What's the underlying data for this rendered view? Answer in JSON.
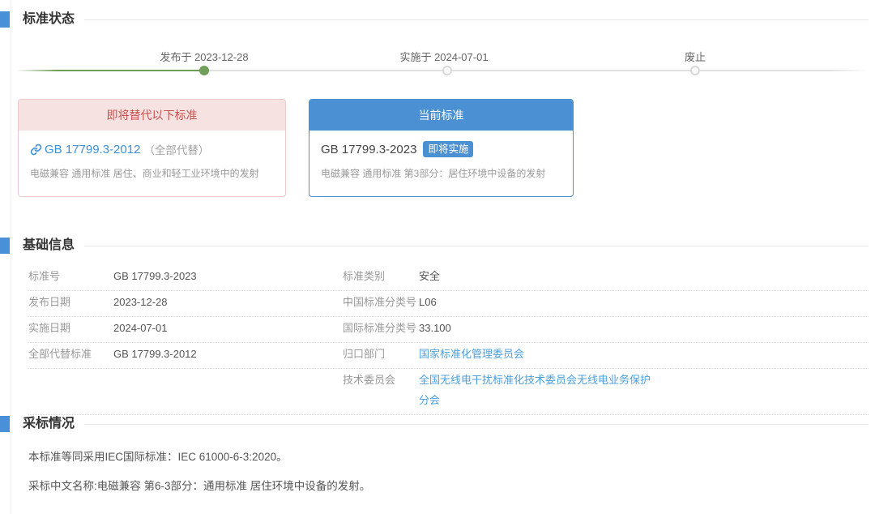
{
  "colors": {
    "accent_blue": "#4a90d9",
    "card_blue": "#4a90d2",
    "timeline_green": "#6f9f58",
    "header_red": "#c9514d",
    "link_blue": "#3d8fd8",
    "table_link_blue": "#4da0dd"
  },
  "sections": {
    "status": {
      "title": "标准状态",
      "timeline": [
        {
          "label": "发布于 2023-12-28",
          "state": "done"
        },
        {
          "label": "实施于 2024-07-01",
          "state": "todo"
        },
        {
          "label": "废止",
          "state": "todo"
        }
      ],
      "replace_card": {
        "header": "即将替代以下标准",
        "link_text": "GB 17799.3-2012",
        "link_suffix": "（全部代替）",
        "subtitle": "电磁兼容 通用标准 居住、商业和轻工业环境中的发射"
      },
      "current_card": {
        "header": "当前标准",
        "title": "GB 17799.3-2023",
        "badge": "即将实施",
        "subtitle": "电磁兼容 通用标准 第3部分：居住环境中设备的发射"
      }
    },
    "basic_info": {
      "title": "基础信息",
      "rows": [
        {
          "l_label": "标准号",
          "l_value": "GB 17799.3-2023",
          "r_label": "标准类别",
          "r_value": "安全"
        },
        {
          "l_label": "发布日期",
          "l_value": "2023-12-28",
          "r_label": "中国标准分类号",
          "r_value": "L06"
        },
        {
          "l_label": "实施日期",
          "l_value": "2024-07-01",
          "r_label": "国际标准分类号",
          "r_value": "33.100"
        },
        {
          "l_label": "全部代替标准",
          "l_value": "GB 17799.3-2012",
          "r_label": "归口部门",
          "r_value": "国家标准化管理委员会"
        },
        {
          "l_label": "",
          "l_value": "",
          "r_label": "技术委员会",
          "r_value": "全国无线电干扰标准化技术委员会无线电业务保护分会"
        }
      ]
    },
    "adoption": {
      "title": "采标情况",
      "lines": [
        "本标准等同采用IEC国际标准：IEC 61000-6-3:2020。",
        "采标中文名称:电磁兼容 第6-3部分：通用标准 居住环境中设备的发射。"
      ]
    }
  }
}
